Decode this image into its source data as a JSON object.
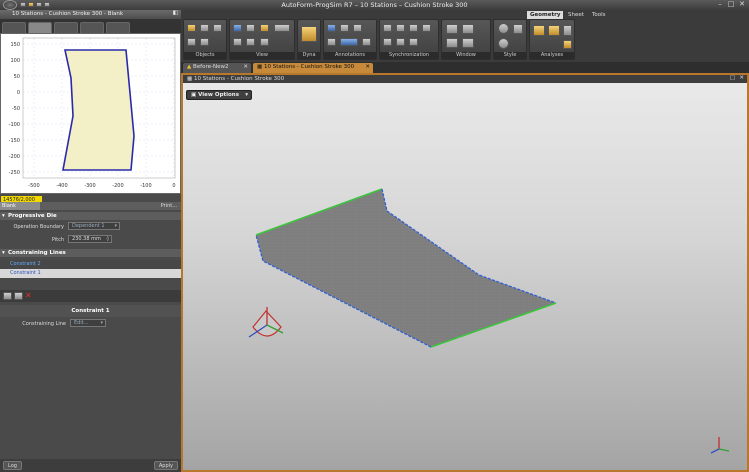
{
  "app": {
    "title": "AutoForm-ProgSim R7 – 10 Stations – Cushion Stroke 300"
  },
  "left_panel": {
    "header": "10 Stations - Cushion Stroke 300 - Blank",
    "plot": {
      "y_ticks": [
        "150",
        "100",
        "50",
        "0",
        "-50",
        "-100",
        "-150",
        "-200",
        "-250"
      ],
      "x_ticks": [
        "-500",
        "-400",
        "-300",
        "-200",
        "-100",
        "0"
      ]
    },
    "coordinate": "14576/2,000 mm",
    "blank_tab": "Blank",
    "print": "Print...",
    "progressive_die": {
      "title": "Progressive Die",
      "operation_boundary_label": "Operation Boundary",
      "operation_boundary_value": "Dependent 1",
      "pitch_label": "Pitch",
      "pitch_value": "230.38 mm"
    },
    "constraining_lines": {
      "title": "Constraining Lines",
      "items": [
        "Constraint 2",
        "Constraint 1"
      ]
    },
    "constraint1": {
      "title": "Constraint 1",
      "line_label": "Constraining Line",
      "line_value": "Edit..."
    },
    "bottom": {
      "log": "Log",
      "apply": "Apply"
    }
  },
  "ribbon": {
    "tabs": [
      "Geometry",
      "Sheet",
      "Tools"
    ],
    "groups": [
      "Objects",
      "View",
      "Dyna",
      "Annotations",
      "Synchronization",
      "Window",
      "Style",
      "Analyses"
    ]
  },
  "doc_tabs": [
    "Before-New2",
    "10 Stations - Cushion Stroke 300"
  ],
  "viewport": {
    "header": "10 Stations - Cushion Stroke 300",
    "view_options": "View Options"
  },
  "colors": {
    "accent": "#b8782b",
    "highlight": "#f0d800",
    "blank_fill": "#f3f0c8",
    "edge_green": "#3cc43c",
    "edge_blue": "#2e5fd8"
  }
}
